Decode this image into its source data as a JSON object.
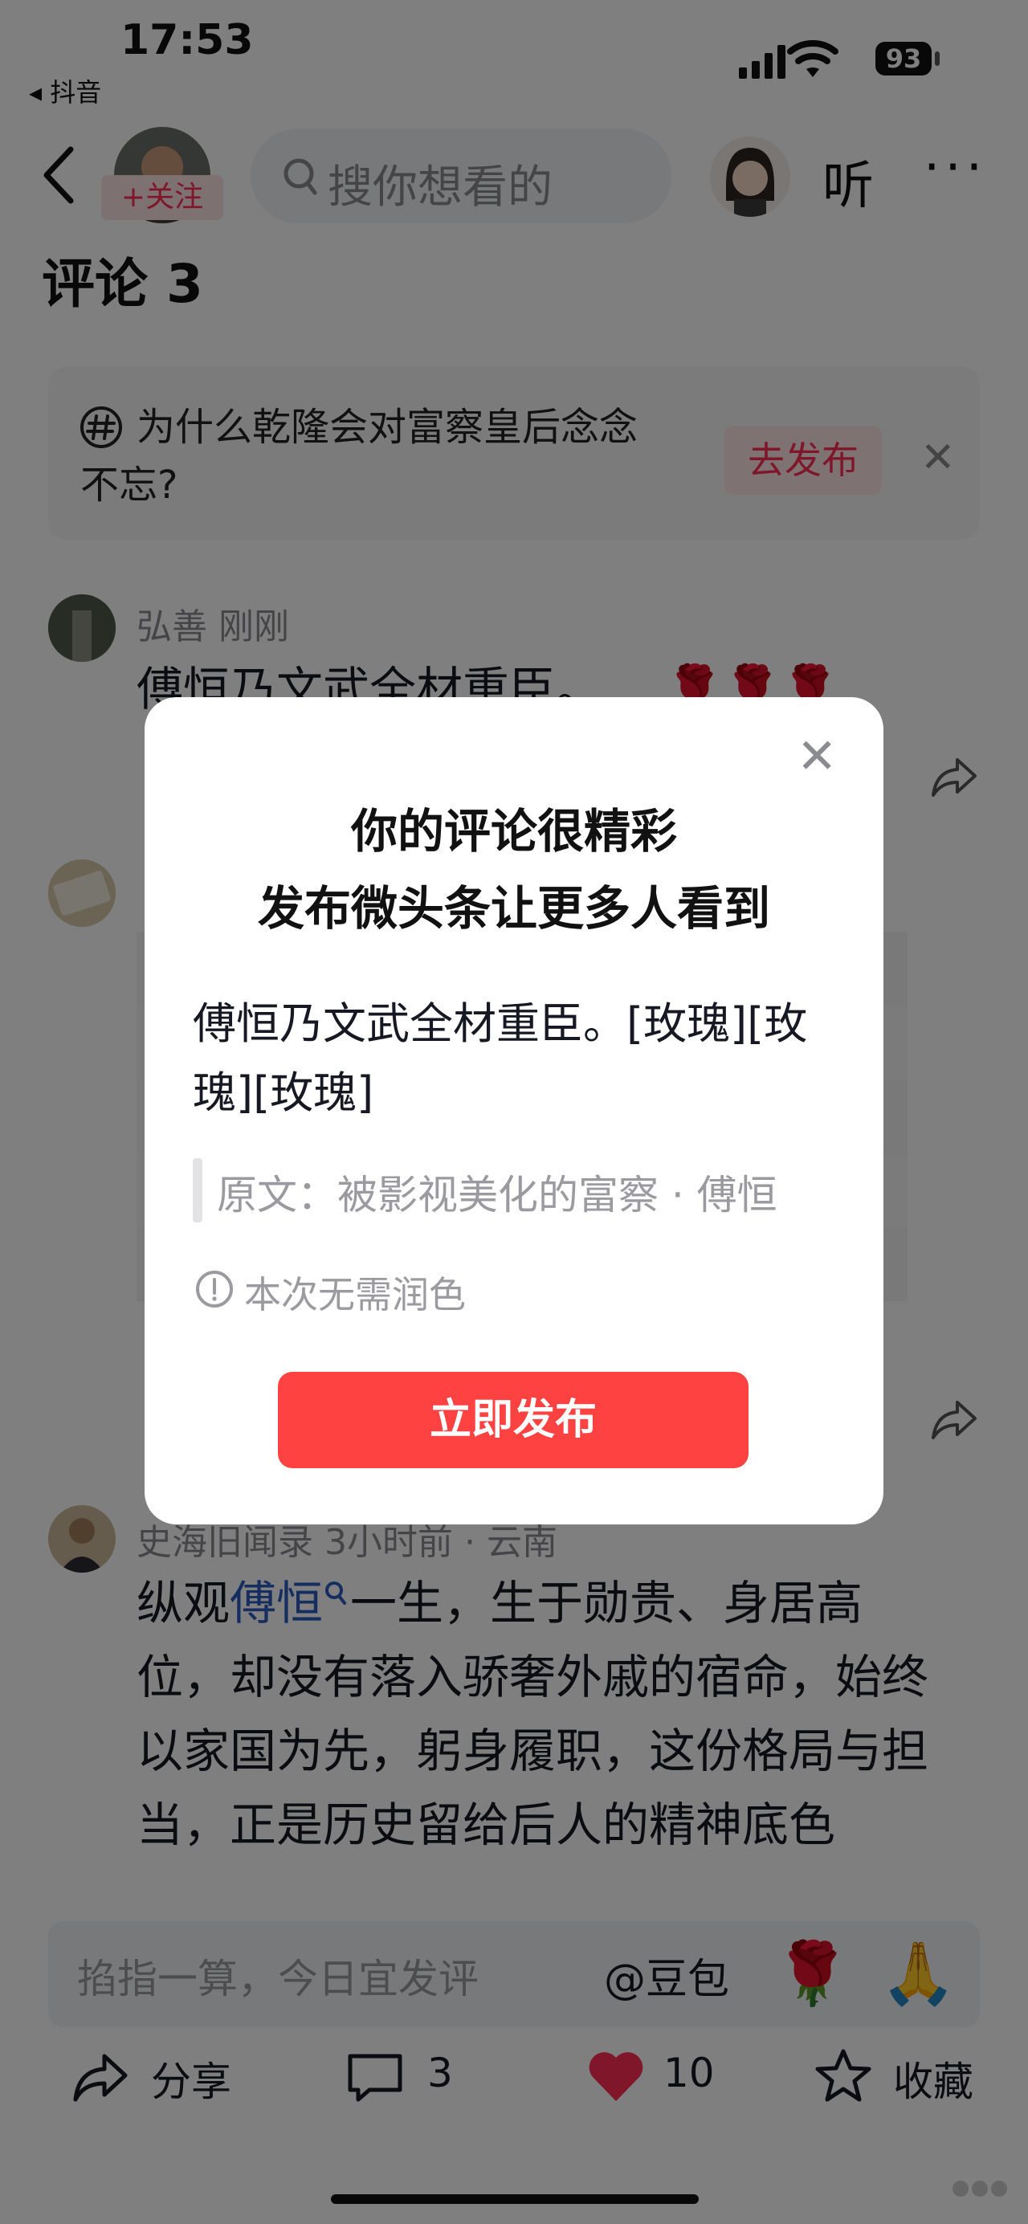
{
  "status_bar": {
    "time": "17:53",
    "back_app": "◂ 抖音",
    "battery": "93"
  },
  "header": {
    "follow_label": "+关注",
    "search_placeholder": "搜你想看的",
    "listen_label": "听",
    "more": "···"
  },
  "comments_title": "评论 3",
  "topic": {
    "text": "为什么乾隆会对富察皇后念念不忘?",
    "publish_label": "去发布",
    "close": "✕"
  },
  "comments": [
    {
      "name": "弘善  刚刚",
      "text": "傅恒乃文武全材重臣。"
    },
    {
      "name": "",
      "text": ""
    },
    {
      "name": "史海旧闻录  3小时前 · 云南",
      "link": "傅恒",
      "text_before": "纵观",
      "text_after": "一生，生于勋贵、身居高位，却没有落入骄奢外戚的宿命，始终以家国为先，躬身履职，这份格局与担当，正是历史留给后人的精神底色"
    }
  ],
  "modal": {
    "title_line1": "你的评论很精彩",
    "title_line2": "发布微头条让更多人看到",
    "body": "傅恒乃文武全材重臣。[玫瑰][玫瑰][玫瑰]",
    "quote": "原文：被影视美化的富察 · 傅恒",
    "note": "本次无需润色",
    "button": "立即发布",
    "close": "✕"
  },
  "input_bar": {
    "placeholder": "掐指一算，今日宜发评",
    "doubao": "@豆包"
  },
  "bottom_bar": {
    "share": "分享",
    "comments": "3",
    "likes": "10",
    "favorite": "收藏"
  },
  "colors": {
    "accent": "#fe2c55",
    "button": "#fe4141",
    "link": "#2a5bbf"
  }
}
